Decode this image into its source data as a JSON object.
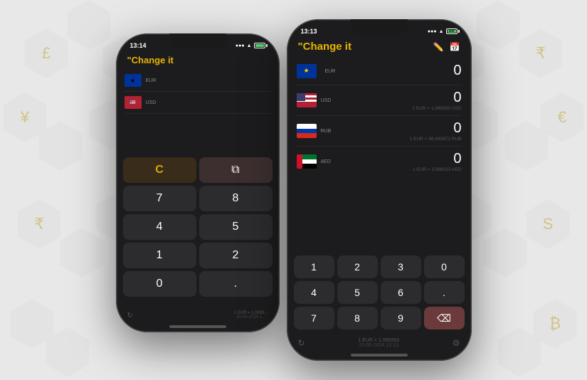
{
  "app": {
    "title": "\"Change it",
    "title_display": "\"Change it"
  },
  "phone_back": {
    "time": "13:14",
    "currencies": [
      {
        "code": "EUR",
        "flag": "eu"
      },
      {
        "code": "USD",
        "flag": "us"
      }
    ],
    "keypad": [
      [
        "C",
        "⧉"
      ],
      [
        "7",
        "8"
      ],
      [
        "4",
        "5"
      ],
      [
        "1",
        "2"
      ],
      [
        "0",
        "."
      ]
    ],
    "footer_rate": "1 EUR = 1,0895...",
    "footer_date": "20-05-2024 1..."
  },
  "phone_front": {
    "time": "13:13",
    "signal": "●●●",
    "wifi": "wifi",
    "battery": "100",
    "currencies": [
      {
        "code": "EUR",
        "flag": "eu",
        "value": "0",
        "rate": ""
      },
      {
        "code": "USD",
        "flag": "us",
        "value": "0",
        "rate": "1 EUR = 1,085993 USD"
      },
      {
        "code": "RUB",
        "flag": "ru",
        "value": "0",
        "rate": "1 EUR = 98,492872 RUB"
      },
      {
        "code": "AED",
        "flag": "ae",
        "value": "0",
        "rate": "1 EUR = 3,998313 AED"
      }
    ],
    "keypad": [
      [
        "1",
        "2",
        "3",
        "0"
      ],
      [
        "4",
        "5",
        "6",
        "."
      ],
      [
        "7",
        "8",
        "9",
        "⌫"
      ]
    ],
    "footer_rate": "1 EUR = 1,085993",
    "footer_date": "22-05-2024 13:13"
  },
  "background": {
    "symbols": [
      "£",
      "¥",
      "₹",
      "€",
      "₿",
      "S",
      "₹",
      "€"
    ],
    "accent_color": "#d4aa00"
  }
}
